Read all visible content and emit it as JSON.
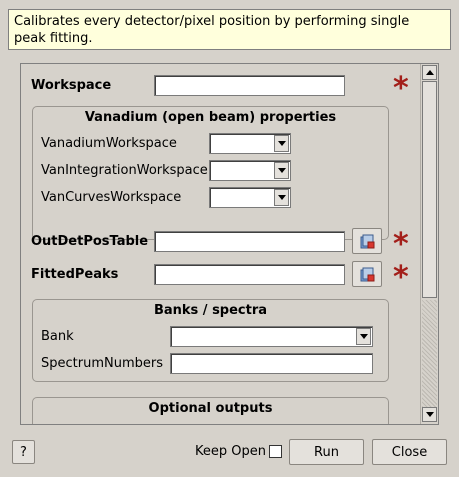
{
  "description": "Calibrates every detector/pixel position by performing single peak fitting.",
  "properties": {
    "workspace": {
      "label": "Workspace",
      "value": ""
    },
    "out_det_pos_table": {
      "label": "OutDetPosTable",
      "value": ""
    },
    "fitted_peaks": {
      "label": "FittedPeaks",
      "value": ""
    }
  },
  "vanadium_group": {
    "title": "Vanadium (open beam) properties",
    "rows": [
      {
        "label": "VanadiumWorkspace",
        "value": ""
      },
      {
        "label": "VanIntegrationWorkspace",
        "value": ""
      },
      {
        "label": "VanCurvesWorkspace",
        "value": ""
      }
    ]
  },
  "banks_group": {
    "title": "Banks / spectra",
    "bank_label": "Bank",
    "bank_value": "",
    "spectrum_label": "SpectrumNumbers",
    "spectrum_value": ""
  },
  "optional_group": {
    "title": "Optional outputs"
  },
  "mandatory_marker": "*",
  "footer": {
    "help_label": "?",
    "keep_open_label": "Keep Open",
    "keep_open_checked": false,
    "run_label": "Run",
    "close_label": "Close"
  },
  "colors": {
    "background": "#d6d2cb",
    "description_bg": "#ffffdc",
    "mandatory_star": "#a31f1a"
  },
  "icons": {
    "browse": "browse-file-icon",
    "scroll_up": "chevron-up-icon",
    "scroll_down": "chevron-down-icon",
    "combo_arrow": "chevron-down-icon"
  }
}
